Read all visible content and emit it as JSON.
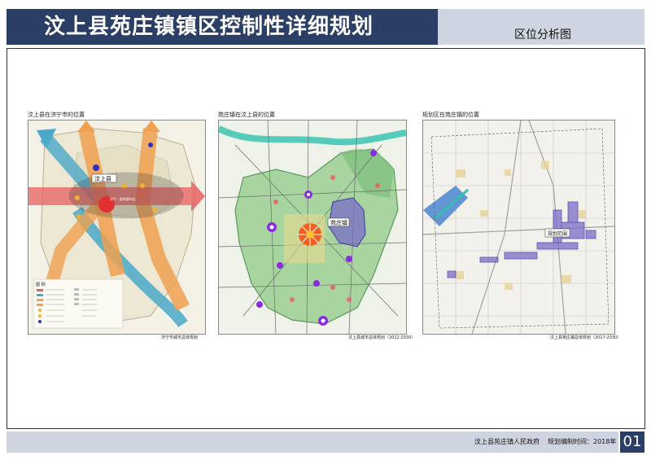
{
  "header": {
    "title": "汶上县苑庄镇镇区控制性详细规划",
    "subtitle": "区位分析图"
  },
  "panels": [
    {
      "label": "汶上县在济宁市的位置",
      "caption": "济宁市城市总体规划",
      "map_labels": [
        "汶上县",
        "济宁 - 曲阜都市区"
      ],
      "legend_title": "图 例"
    },
    {
      "label": "苑庄镇在汶上县的位置",
      "caption": "汶上县城市总体规划（2012-2030）",
      "map_labels": [
        "苑庄镇"
      ]
    },
    {
      "label": "规划区在苑庄镇的位置",
      "caption": "汶上县苑庄镇总体规划（2017-2030）",
      "map_labels": [
        "规划范围"
      ]
    }
  ],
  "footer": {
    "authority": "汶上县苑庄镇人民政府",
    "date": "规划编制时间：2018年",
    "page": "01"
  },
  "colors": {
    "header": "#2b3e66",
    "header_side": "#cfd5e0",
    "orange_axis": "#f0a050",
    "blue_river": "#4aa8c8",
    "red_axis": "#e86060",
    "green_land": "#a8d4a0",
    "purple_zone": "#7b6cc8"
  }
}
